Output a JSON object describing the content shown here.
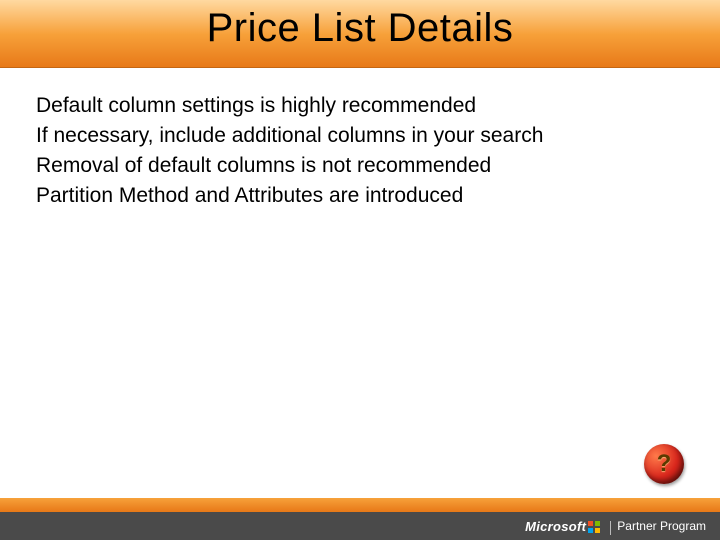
{
  "title": "Price List Details",
  "bullets": [
    "Default column settings is highly recommended",
    "If necessary, include additional columns in your search",
    "Removal of default columns is not recommended",
    "Partition Method and Attributes are introduced"
  ],
  "help_glyph": "?",
  "footer": {
    "brand": "Microsoft",
    "program": "Partner Program"
  }
}
